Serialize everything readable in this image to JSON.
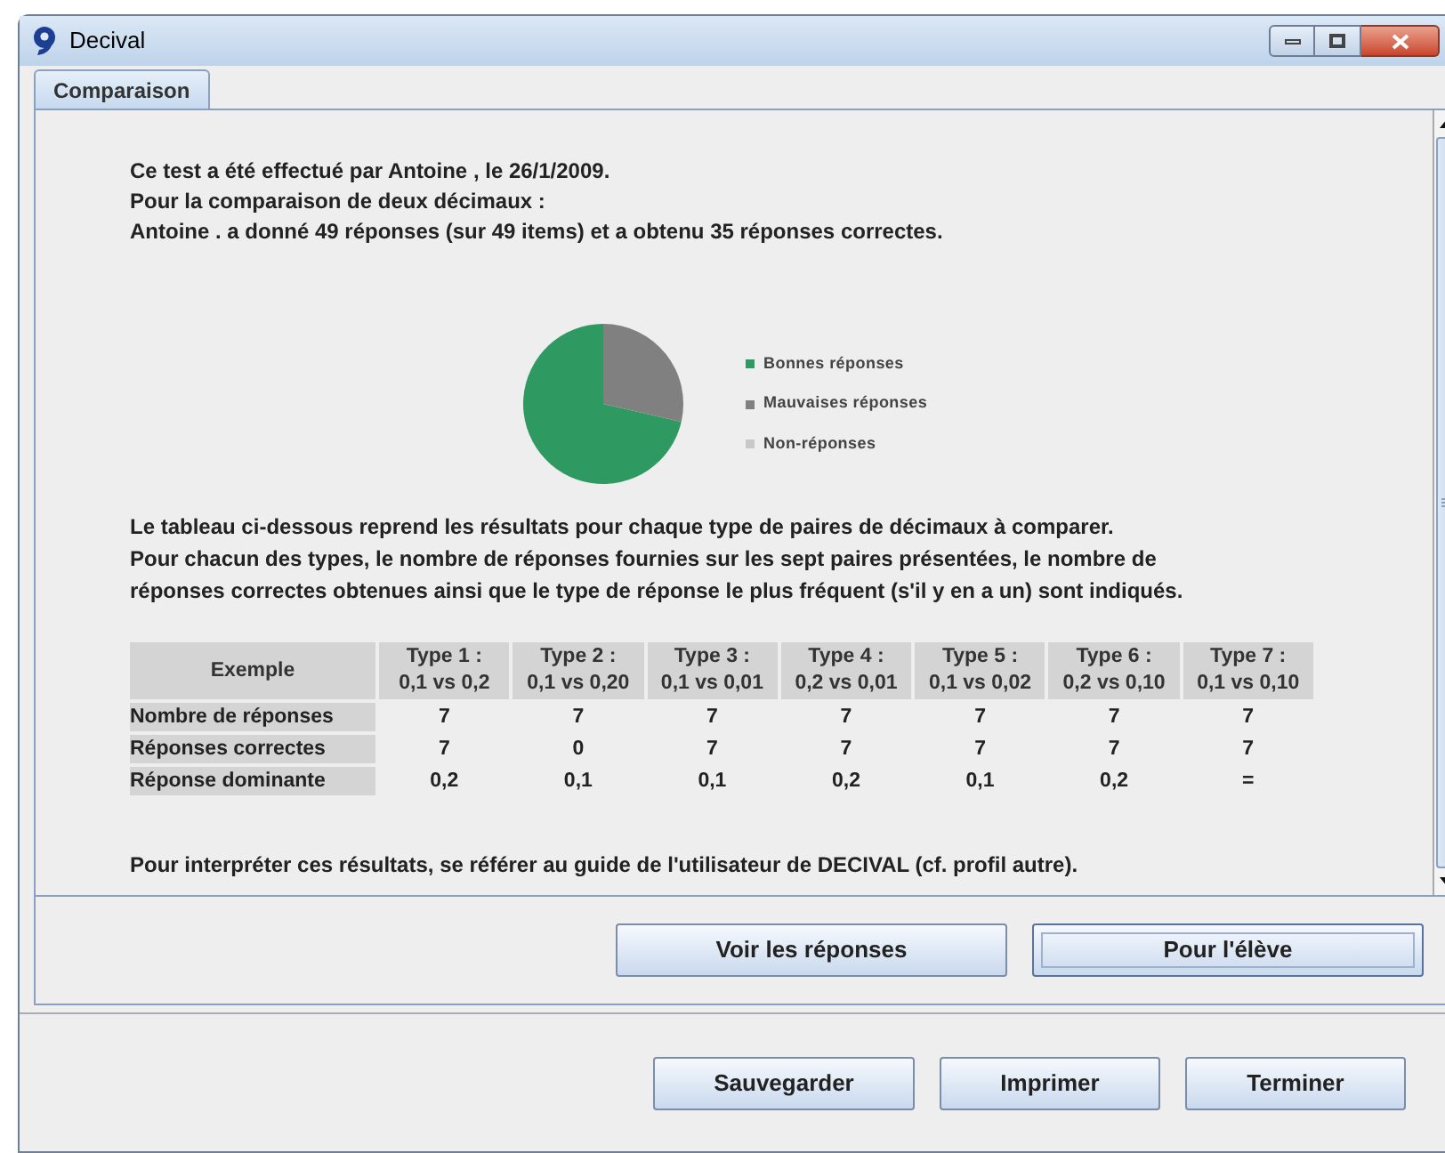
{
  "window": {
    "title": "Decival"
  },
  "tabs": [
    {
      "label": "Comparaison",
      "selected": true
    }
  ],
  "intro": [
    "Ce test a été effectué par Antoine , le 26/1/2009.",
    "Pour la comparaison de deux décimaux :",
    "Antoine . a donné 49 réponses (sur 49 items) et a obtenu 35 réponses correctes."
  ],
  "chart_data": {
    "type": "pie",
    "categories": [
      "Bonnes réponses",
      "Mauvaises réponses",
      "Non-réponses"
    ],
    "values": [
      71.4,
      28.6,
      0
    ],
    "colors": [
      "#2e9a62",
      "#808080",
      "#c8c8c8"
    ],
    "legend": "right"
  },
  "description": [
    "Le tableau ci-dessous reprend les résultats pour chaque type de paires de décimaux à comparer.",
    "Pour chacun des types, le nombre de réponses fournies sur les sept paires présentées, le nombre de",
    "réponses correctes obtenues ainsi que le type de réponse le plus fréquent (s'il y en a un) sont indiqués."
  ],
  "table": {
    "header": [
      "Exemple",
      "Type 1 :\n0,1 vs 0,2",
      "Type 2 :\n0,1 vs 0,20",
      "Type 3 :\n0,1 vs 0,01",
      "Type 4 :\n0,2 vs 0,01",
      "Type 5 :\n0,1 vs 0,02",
      "Type 6 :\n0,2 vs 0,10",
      "Type 7 :\n0,1 vs 0,10"
    ],
    "rows": [
      [
        "Nombre de réponses",
        "7",
        "7",
        "7",
        "7",
        "7",
        "7",
        "7"
      ],
      [
        "Réponses correctes",
        "7",
        "0",
        "7",
        "7",
        "7",
        "7",
        "7"
      ],
      [
        "Réponse dominante",
        "0,2",
        "0,1",
        "0,1",
        "0,2",
        "0,1",
        "0,2",
        "="
      ]
    ]
  },
  "footnote": "Pour interpréter ces résultats, se référer au guide de l'utilisateur de DECIVAL (cf. profil autre).",
  "panel_buttons": [
    {
      "label": "Voir les réponses",
      "focused": false
    },
    {
      "label": "Pour l'élève",
      "focused": true
    }
  ],
  "bottom_buttons": [
    "Sauvegarder",
    "Imprimer",
    "Terminer"
  ]
}
